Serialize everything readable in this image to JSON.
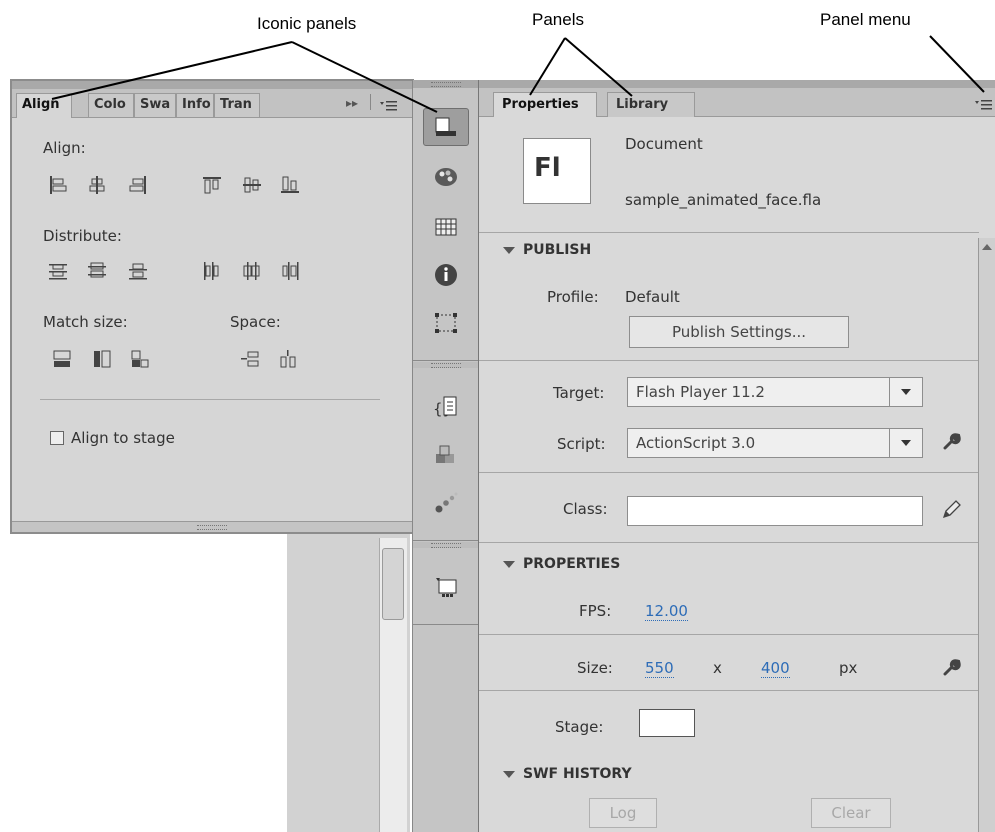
{
  "callouts": {
    "iconic_panels": "Iconic panels",
    "panels": "Panels",
    "panel_menu": "Panel menu"
  },
  "align_panel": {
    "tabs": [
      "Align",
      "Colo",
      "Swa",
      "Info",
      "Tran"
    ],
    "more": "▸▸",
    "align_label": "Align:",
    "distribute_label": "Distribute:",
    "match_size_label": "Match size:",
    "space_label": "Space:",
    "align_to_stage_label": "Align to stage",
    "align_to_stage_checked": false
  },
  "dock": {
    "icons": [
      "properties-icon",
      "color-icon",
      "swatches-icon",
      "info-icon",
      "transform-icon",
      "actions-icon",
      "components-icon",
      "motion-presets-icon",
      "library-icon"
    ]
  },
  "properties_panel": {
    "tabs": [
      "Properties",
      "Library"
    ],
    "doc_logo": "Fl",
    "doc_type": "Document",
    "file_name": "sample_animated_face.fla",
    "publish": {
      "header": "PUBLISH",
      "profile_label": "Profile:",
      "profile_value": "Default",
      "publish_settings_button": "Publish Settings...",
      "target_label": "Target:",
      "target_value": "Flash Player 11.2",
      "script_label": "Script:",
      "script_value": "ActionScript 3.0",
      "class_label": "Class:",
      "class_value": ""
    },
    "properties": {
      "header": "PROPERTIES",
      "fps_label": "FPS:",
      "fps_value": "12.00",
      "size_label": "Size:",
      "width_value": "550",
      "x_label": "x",
      "height_value": "400",
      "unit": "px",
      "stage_label": "Stage:",
      "stage_color": "#ffffff"
    },
    "swf_history": {
      "header": "SWF HISTORY",
      "log_button": "Log",
      "clear_button": "Clear"
    }
  }
}
